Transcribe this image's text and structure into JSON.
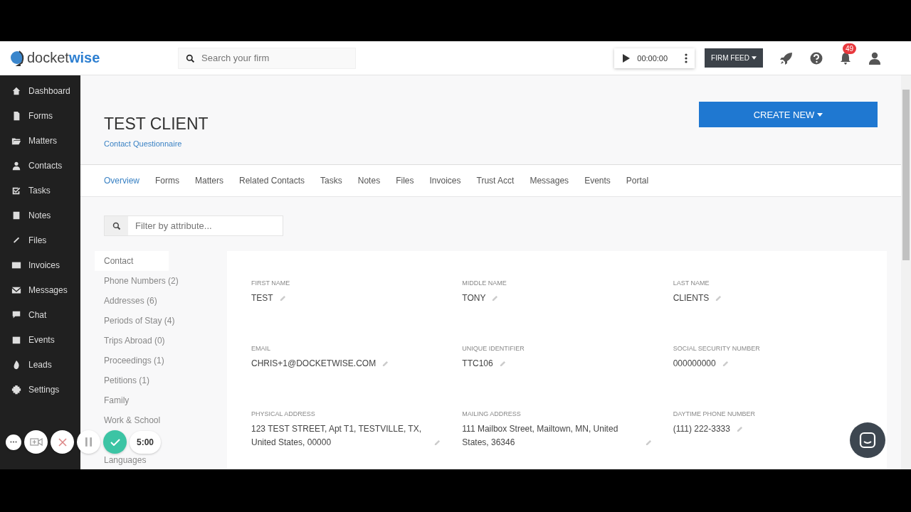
{
  "brand": {
    "name_part_1": "docket",
    "name_part_2": "wise"
  },
  "search": {
    "placeholder": "Search your firm"
  },
  "timer": {
    "time": "00:00:00"
  },
  "firm_feed": {
    "label": "FIRM FEED"
  },
  "notifications": {
    "count": "49"
  },
  "sidebar": {
    "items": [
      {
        "label": "Dashboard"
      },
      {
        "label": "Forms"
      },
      {
        "label": "Matters"
      },
      {
        "label": "Contacts"
      },
      {
        "label": "Tasks"
      },
      {
        "label": "Notes"
      },
      {
        "label": "Files"
      },
      {
        "label": "Invoices"
      },
      {
        "label": "Messages"
      },
      {
        "label": "Chat"
      },
      {
        "label": "Events"
      },
      {
        "label": "Leads"
      },
      {
        "label": "Settings"
      }
    ]
  },
  "page": {
    "title": "TEST CLIENT",
    "subtitle_link": "Contact Questionnaire",
    "create_button": "CREATE NEW"
  },
  "tabs": [
    {
      "label": "Overview",
      "selected": true
    },
    {
      "label": "Forms",
      "selected": false
    },
    {
      "label": "Matters",
      "selected": false
    },
    {
      "label": "Related Contacts",
      "selected": false
    },
    {
      "label": "Tasks",
      "selected": false
    },
    {
      "label": "Notes",
      "selected": false
    },
    {
      "label": "Files",
      "selected": false
    },
    {
      "label": "Invoices",
      "selected": false
    },
    {
      "label": "Trust Acct",
      "selected": false
    },
    {
      "label": "Messages",
      "selected": false
    },
    {
      "label": "Events",
      "selected": false
    },
    {
      "label": "Portal",
      "selected": false
    }
  ],
  "filter": {
    "placeholder": "Filter by attribute..."
  },
  "categories": [
    {
      "label": "Contact",
      "selected": true
    },
    {
      "label": "Phone Numbers (2)",
      "selected": false
    },
    {
      "label": "Addresses (6)",
      "selected": false
    },
    {
      "label": "Periods of Stay (4)",
      "selected": false
    },
    {
      "label": "Trips Abroad (0)",
      "selected": false
    },
    {
      "label": "Proceedings (1)",
      "selected": false
    },
    {
      "label": "Petitions (1)",
      "selected": false
    },
    {
      "label": "Family",
      "selected": false
    },
    {
      "label": "Work & School",
      "selected": false
    },
    {
      "label": "Languages",
      "selected": false
    }
  ],
  "fields": [
    {
      "label": "FIRST NAME",
      "value": "TEST"
    },
    {
      "label": "MIDDLE NAME",
      "value": "TONY"
    },
    {
      "label": "LAST NAME",
      "value": "CLIENTS"
    },
    {
      "label": "EMAIL",
      "value": "CHRIS+1@DOCKETWISE.COM"
    },
    {
      "label": "UNIQUE IDENTIFIER",
      "value": "TTC106"
    },
    {
      "label": "SOCIAL SECURITY NUMBER",
      "value": "000000000"
    },
    {
      "label": "PHYSICAL ADDRESS",
      "value": "123 TEST STREET, Apt T1, TESTVILLE, TX, United States, 00000"
    },
    {
      "label": "MAILING ADDRESS",
      "value": "111 Mailbox Street, Mailtown, MN, United States, 36346"
    },
    {
      "label": "DAYTIME PHONE NUMBER",
      "value": "(111) 222-3333"
    }
  ],
  "recorder": {
    "countdown": "5:00"
  }
}
